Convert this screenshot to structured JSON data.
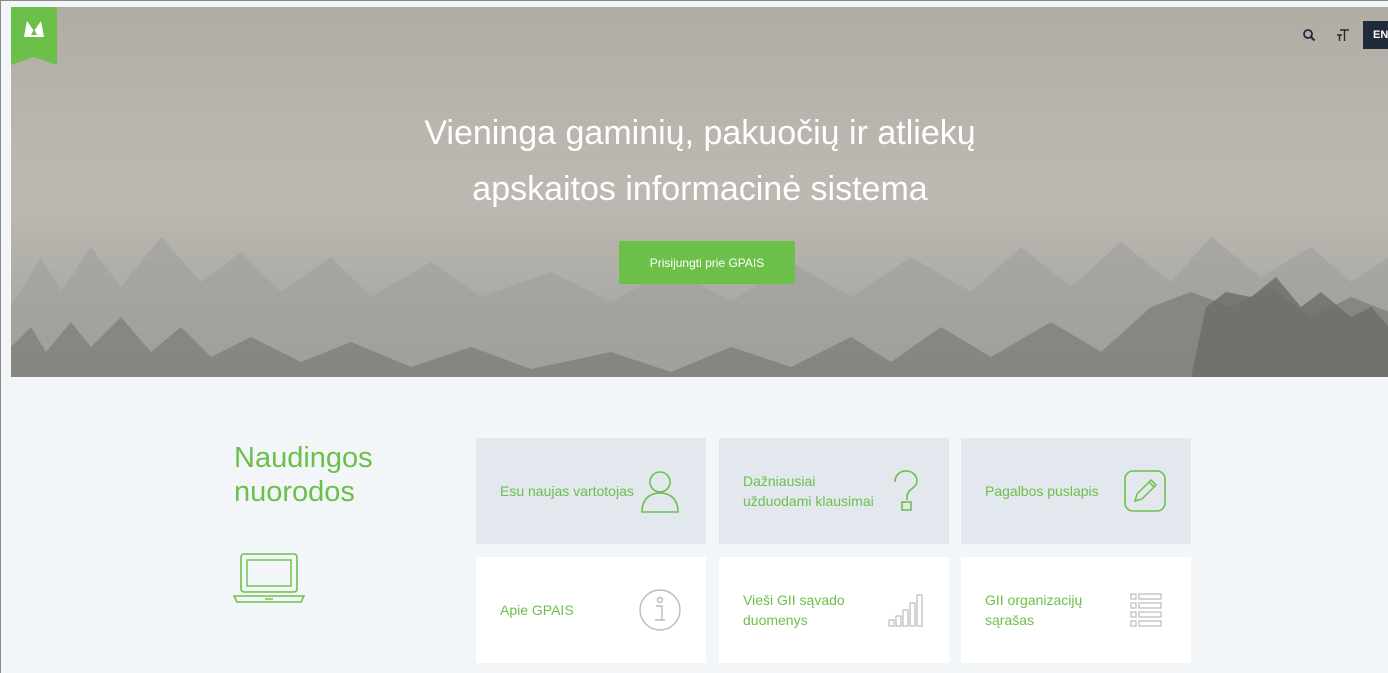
{
  "header": {
    "search_icon": "search-icon",
    "text_size_icon": "text-size-icon",
    "language_label": "EN"
  },
  "hero": {
    "title_line1": "Vieninga gaminių, pakuočių ir atliekų",
    "title_line2": "apskaitos informacinė sistema",
    "login_button": "Prisijungti prie GPAIS"
  },
  "links": {
    "title_line1": "Naudingos",
    "title_line2": "nuorodos",
    "cards": [
      {
        "label": "Esu naujas vartotojas",
        "icon": "user-icon"
      },
      {
        "label": "Dažniausiai užduodami klausimai",
        "icon": "question-icon"
      },
      {
        "label": "Pagalbos puslapis",
        "icon": "pencil-icon"
      },
      {
        "label": "Apie GPAIS",
        "icon": "info-icon"
      },
      {
        "label": "Vieši GII sąvado duomenys",
        "icon": "bar-chart-icon"
      },
      {
        "label": "GII organizacijų sąrašas",
        "icon": "list-icon"
      }
    ]
  },
  "colors": {
    "accent_green": "#6cc04a",
    "lang_button_bg": "#1f2b3b",
    "card_grey": "#e2e8ed",
    "page_bg": "#f3f6f9"
  }
}
